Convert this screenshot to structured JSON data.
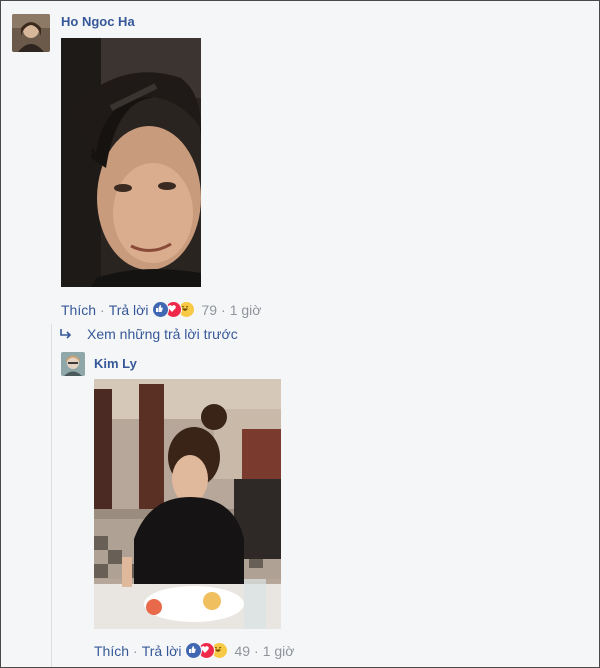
{
  "comments": [
    {
      "author": "Ho Ngoc Ha",
      "actions": {
        "like": "Thích",
        "reply": "Trả lời"
      },
      "reactions": [
        "like-reaction-icon",
        "love-reaction-icon",
        "haha-reaction-icon"
      ],
      "reaction_count": "79",
      "time": "1 giờ"
    },
    {
      "author": "Kim Ly",
      "actions": {
        "like": "Thích",
        "reply": "Trả lời"
      },
      "reactions": [
        "like-reaction-icon",
        "love-reaction-icon",
        "haha-reaction-icon"
      ],
      "reaction_count": "49",
      "time": "1 giờ"
    }
  ],
  "thread": {
    "view_previous": "Xem những trả lời trước"
  },
  "separator": "·",
  "colors": {
    "link": "#365899",
    "meta": "#90949c",
    "like": "#4267b2",
    "love": "#f0284a",
    "haha": "#f7c944",
    "background": "#f5f6f7"
  }
}
